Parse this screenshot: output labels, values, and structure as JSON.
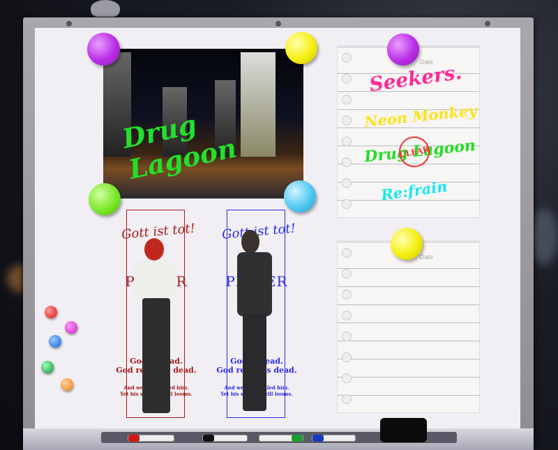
{
  "photo": {
    "title": "Drug Lagoon"
  },
  "note1": {
    "date_label": "Date",
    "lines": [
      {
        "text": "Seekers.",
        "color": "#ff2a9a"
      },
      {
        "text": "Neon Monkey",
        "color": "#ffe21a"
      },
      {
        "text": "Drug Lagoon",
        "color": "#22dd22"
      },
      {
        "text": "Re:frain",
        "color": "#19e8f0"
      }
    ],
    "stamp": "CLEAR"
  },
  "note2": {
    "date_label": "Date"
  },
  "cards": [
    {
      "script": "Gott ist tot!",
      "title": "PLAYER",
      "line1": "God is dead.",
      "line2": "God remains dead.",
      "small1": "And we have killed him.",
      "small2": "Yet his shadow still looms.",
      "color": "#a81818"
    },
    {
      "script": "Gott ist tot!",
      "title": "PLAYER",
      "line1": "God is dead.",
      "line2": "God remains dead.",
      "small1": "And we have killed him.",
      "small2": "Yet his shadow still looms.",
      "color": "#2a2ae8"
    }
  ],
  "colors": {
    "pin_purple": "#b92de6",
    "pin_yellow": "#f5ef10",
    "pin_green": "#7be82a",
    "pin_blue": "#52c8f5"
  }
}
